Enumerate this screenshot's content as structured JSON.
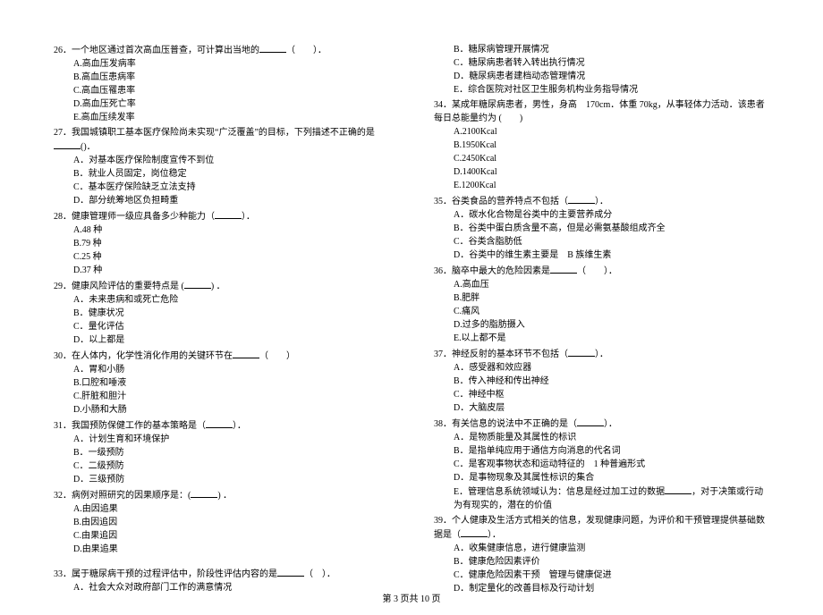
{
  "left": {
    "q26": {
      "stem": "26．一个地区通过首次高血压普查，可计算出当地的",
      "paren": "（　　）．",
      "a": "A.高血压发病率",
      "b": "B.高血压患病率",
      "c": "C.高血压罹患率",
      "d": "D.高血压死亡率",
      "e": "E.高血压续发率"
    },
    "q27": {
      "stem": "27．我国城镇职工基本医疗保险尚未实现“广泛覆盖”的目标，下列描述不正确的是",
      "paren": "()．",
      "a": "A．对基本医疗保险制度宣传不到位",
      "b": "B．就业人员固定，岗位稳定",
      "c": "C．基本医疗保险缺乏立法支持",
      "d": "D．部分统筹地区负担畸重"
    },
    "q28": {
      "stem": "28．健康管理师一级应具备多少种能力（",
      "paren": "）．",
      "a": "A.48 种",
      "b": "B.79 种",
      "c": "C.25 种",
      "d": "D.37 种"
    },
    "q29": {
      "stem": "29．健康风险评估的重要特点是 (",
      "paren": ") ．",
      "a": "A．未来患病和或死亡危险",
      "b": "B．健康状况",
      "c": "C．量化评估",
      "d": "D．以上都是"
    },
    "q30": {
      "stem": "30．在人体内，化学性消化作用的关键环节在",
      "paren": "（　　）",
      "a": "A．胃和小肠",
      "b": "B.口腔和唾液",
      "c": "C.肝脏和胆汁",
      "d": "D.小肠和大肠"
    },
    "q31": {
      "stem": "31．我国预防保健工作的基本策略是（",
      "paren": "）．",
      "a": "A．计划生育和环境保护",
      "b": "B．一级预防",
      "c": "C．二级预防",
      "d": "D．三级预防"
    },
    "q32": {
      "stem": "32．病例对照研究的因果顺序是：(",
      "paren": ") ．",
      "a": "A.由因追果",
      "b": "B.由因追因",
      "c": "C.由果追因",
      "d": "D.由果追果"
    },
    "q33": {
      "stem": "33．属于糖尿病干预的过程评估中，阶段性评估内容的是",
      "paren": "（　）．",
      "a": "A．社会大众对政府部门工作的满意情况"
    }
  },
  "right": {
    "q33_cont": {
      "b": "B．糖尿病管理开展情况",
      "c": "C．糖尿病患者转入转出执行情况",
      "d": "D．糖尿病患者建档动态管理情况",
      "e": "E．综合医院对社区卫生服务机构业务指导情况"
    },
    "q34": {
      "stem": "34．某成年糖尿病患者，男性，身高　170cm．体重 70kg，从事轻体力活动．该患者每日总能量约为 (　　)",
      "a": "A.2100Kcal",
      "b": "B.1950Kcal",
      "c": "C.2450Kcal",
      "d": "D.1400Kcal",
      "e": "E.1200Kcal"
    },
    "q35": {
      "stem": "35．谷类食品的营养特点不包括（",
      "paren": "）．",
      "a": "A．碳水化合物是谷类中的主要营养成分",
      "b": "B．谷类中蛋白质含量不高，但是必需氨基酸组成齐全",
      "c": "C．谷类含脂肪低",
      "d": "D．谷类中的维生素主要是　B 族维生素"
    },
    "q36": {
      "stem": "36．脑卒中最大的危险因素是",
      "paren": "（　　）．",
      "a": "A.高血压",
      "b": "B.肥胖",
      "c": "C.痛风",
      "d": "D.过多的脂肪摄入",
      "e": "E.以上都不是"
    },
    "q37": {
      "stem": "37．神经反射的基本环节不包括（",
      "paren": "）．",
      "a": "A．感受器和效应器",
      "b": "B．传入神经和传出神经",
      "c": "C．神经中枢",
      "d": "D．大脑皮层"
    },
    "q38": {
      "stem": "38．有关信息的说法中不正确的是（",
      "paren": "）．",
      "a": "A．是物质能量及其属性的标识",
      "b": "B．是指单纯应用于通信方向消息的代名词",
      "c": "C．是客观事物状态和运动特征的　1 种普遍形式",
      "d": "D．是事物现象及其属性标识的集合",
      "e": "E．管理信息系统领域认为：信息是经过加工过的数据",
      "e_tail": "，对于决策或行动为有现实的，潜在的价值"
    },
    "q39": {
      "stem": "39．个人健康及生活方式相关的信息，发现健康问题，为评价和干预管理提供基础数据是（",
      "paren": "）．",
      "a": "A．收集健康信息，进行健康监测",
      "b": "B．健康危险因素评价",
      "c": "C．健康危险因素干预　管理与健康促进",
      "d": "D．制定量化的改善目标及行动计划"
    }
  },
  "footer": "第 3 页共 10 页"
}
